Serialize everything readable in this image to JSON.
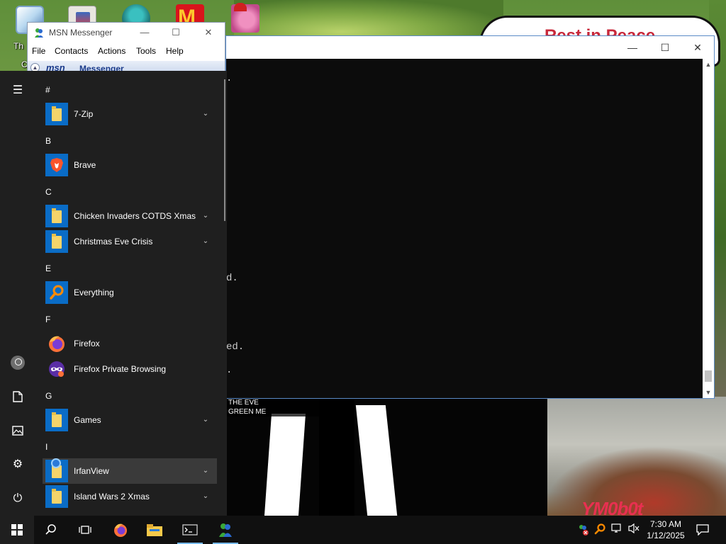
{
  "desktop": {
    "banner_text": "Rest in Peace",
    "label_partial_1": "Th",
    "label_partial_2": "C",
    "overlay_text_1": "THE EVE",
    "overlay_text_2": "GREEN ME",
    "watermark": "YM0b0t",
    "icons": [
      "browser-shortcut-icon",
      "setup-shortcut-icon",
      "character-shortcut-icon",
      "mcdonalds-shortcut-icon",
      "pig-shortcut-icon"
    ]
  },
  "msn": {
    "title": "MSN Messenger",
    "menus": [
      "File",
      "Contacts",
      "Actions",
      "Tools",
      "Help"
    ],
    "brand": "msn",
    "brand_word": "Messenger"
  },
  "console": {
    "lines": [
      ".",
      "d.",
      "ed.",
      "."
    ]
  },
  "start_menu": {
    "sections": [
      {
        "letter": "#",
        "apps": [
          {
            "name": "7-Zip",
            "icon": "folder-icon",
            "expandable": true
          }
        ]
      },
      {
        "letter": "B",
        "apps": [
          {
            "name": "Brave",
            "icon": "brave-icon",
            "expandable": false
          }
        ]
      },
      {
        "letter": "C",
        "apps": [
          {
            "name": "Chicken Invaders COTDS Xmas",
            "icon": "folder-icon",
            "expandable": true
          },
          {
            "name": "Christmas Eve Crisis",
            "icon": "folder-icon",
            "expandable": true
          }
        ]
      },
      {
        "letter": "E",
        "apps": [
          {
            "name": "Everything",
            "icon": "search-magnifier-icon",
            "expandable": false
          }
        ]
      },
      {
        "letter": "F",
        "apps": [
          {
            "name": "Firefox",
            "icon": "firefox-icon",
            "expandable": false
          },
          {
            "name": "Firefox Private Browsing",
            "icon": "firefox-private-icon",
            "expandable": false
          }
        ]
      },
      {
        "letter": "G",
        "apps": [
          {
            "name": "Games",
            "icon": "folder-icon",
            "expandable": true
          }
        ]
      },
      {
        "letter": "I",
        "apps": [
          {
            "name": "IrfanView",
            "icon": "folder-icon",
            "expandable": true,
            "hovered": true
          },
          {
            "name": "Island Wars 2 Xmas",
            "icon": "folder-icon",
            "expandable": true
          }
        ]
      }
    ]
  },
  "taskbar": {
    "time": "7:30 AM",
    "date": "1/12/2025",
    "pinned": [
      "start-button",
      "search-button",
      "task-view-button",
      "firefox-button",
      "file-explorer-button",
      "terminal-button",
      "msn-messenger-button"
    ],
    "tray": [
      "msn-status-icon",
      "everything-tray-icon",
      "network-icon",
      "volume-muted-icon"
    ]
  },
  "colors": {
    "start_menu_bg": "#1f1f1f",
    "tile_blue": "#0a6cc6",
    "taskbar_bg": "#101010",
    "console_bg": "#0c0c0c",
    "active_indicator": "#76b9ed"
  }
}
